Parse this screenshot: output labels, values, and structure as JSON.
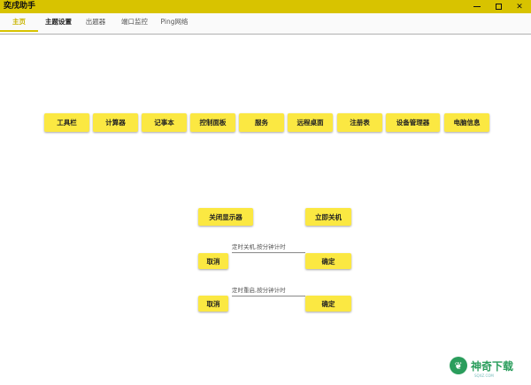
{
  "window": {
    "title": "奕戌助手",
    "controls": {
      "minimize": "—",
      "maximize": "□",
      "close": "✕"
    }
  },
  "tabs": [
    {
      "label": "主页",
      "active": true
    },
    {
      "label": "主题设置",
      "active": false
    },
    {
      "label": "出题器",
      "active": false
    },
    {
      "label": "端口监控",
      "active": false
    },
    {
      "label": "Ping网络",
      "active": false
    }
  ],
  "tools": [
    {
      "label": "工具栏"
    },
    {
      "label": "计算器"
    },
    {
      "label": "记事本"
    },
    {
      "label": "控制面板"
    },
    {
      "label": "服务"
    },
    {
      "label": "远程桌面"
    },
    {
      "label": "注册表"
    },
    {
      "label": "设备管理器"
    },
    {
      "label": "电脑信息"
    }
  ],
  "power": {
    "close_display": "关闭显示器",
    "shutdown_now": "立即关机",
    "timed_shutdown": {
      "placeholder": "定时关机,按分钟计时",
      "value": "",
      "cancel": "取消",
      "confirm": "确定"
    },
    "timed_restart": {
      "placeholder": "定时重启,按分钟计时",
      "value": "",
      "cancel": "取消",
      "confirm": "确定"
    }
  },
  "colors": {
    "accent": "#d8c300",
    "button": "#fbe842",
    "tab_active": "#c9b400"
  },
  "watermark": {
    "icon": "leaf-icon",
    "text": "神奇下载",
    "url": "SQXZ.COM"
  }
}
